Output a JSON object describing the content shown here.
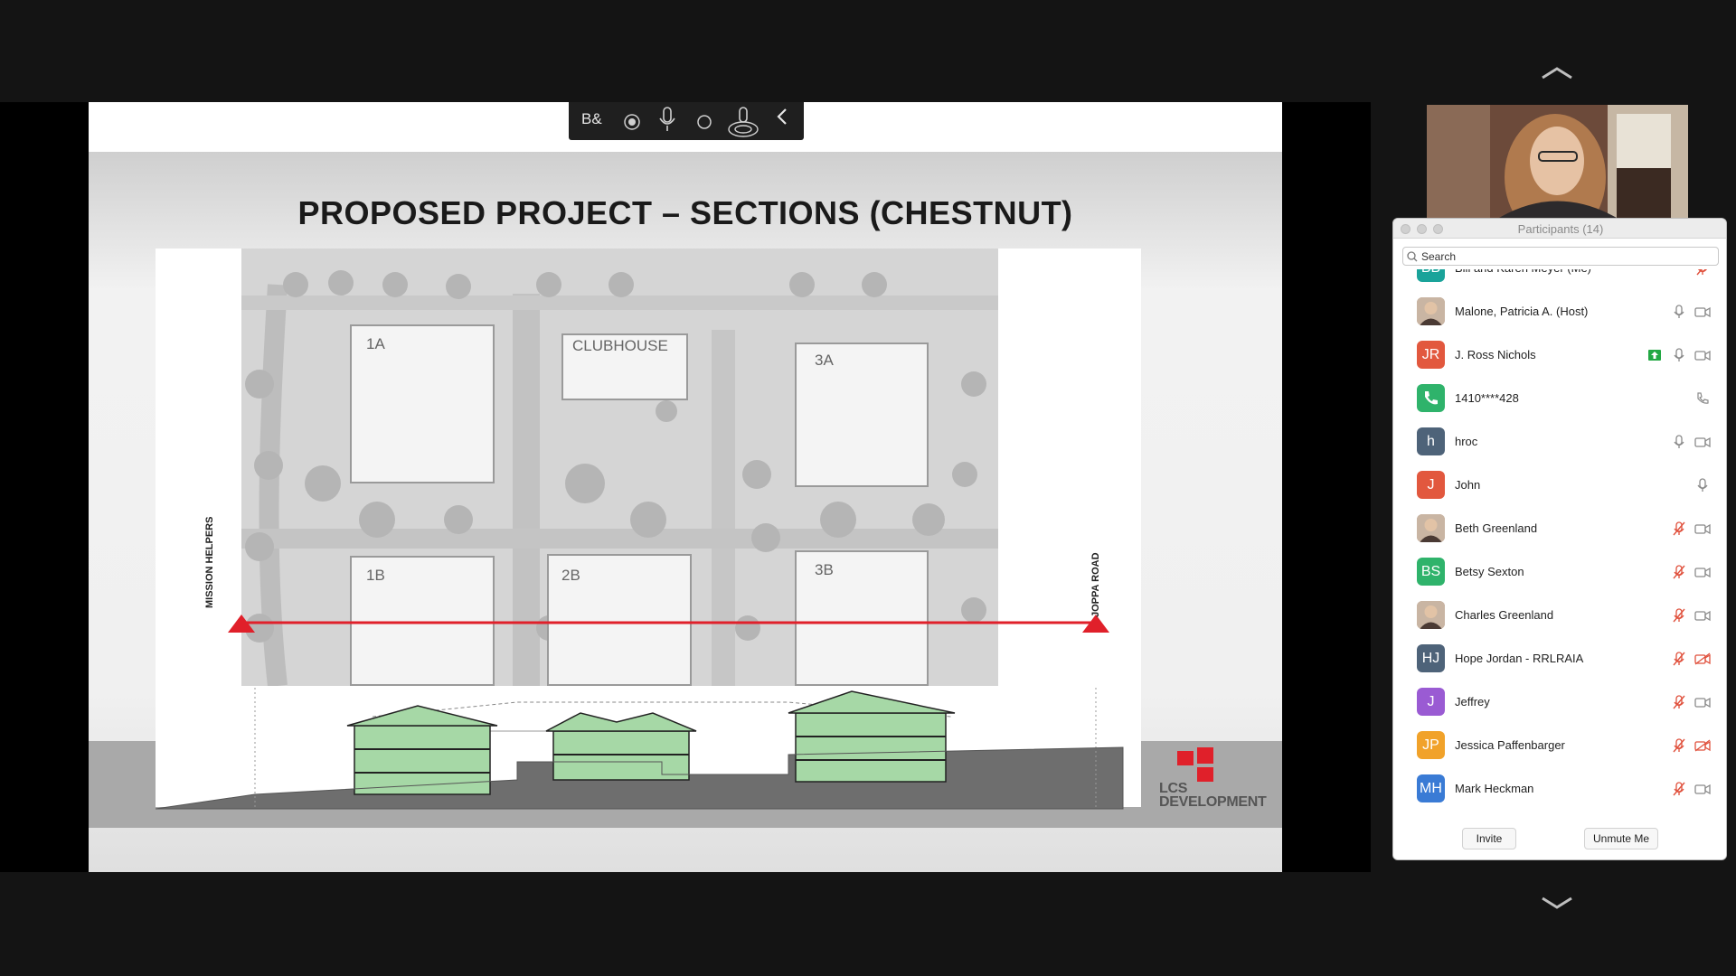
{
  "slide": {
    "title": "PROPOSED PROJECT – SECTIONS (CHESTNUT)",
    "buildings": [
      "1A",
      "CLUBHOUSE",
      "3A",
      "1B",
      "2B",
      "3B"
    ],
    "road_left": "MISSION HELPERS",
    "road_right": "JOPPA ROAD",
    "logo_line1": "LCS",
    "logo_line2": "DEVELOPMENT"
  },
  "share_toolbar": {
    "icons": [
      "annotate-icon",
      "record-dot-icon",
      "mic-icon",
      "circle-icon",
      "podcast-icon",
      "collapse-chevron-icon"
    ]
  },
  "participants_panel": {
    "title": "Participants (14)",
    "search_placeholder": "Search",
    "invite_label": "Invite",
    "unmute_label": "Unmute Me",
    "colors": {
      "green": "#2fb36b",
      "red": "#e2583e",
      "slate": "#4e6379",
      "purple": "#9a5bd3",
      "orange": "#f1a22a",
      "teal": "#1aa39a",
      "blue": "#3a7bd5",
      "muted": "#e0503c"
    },
    "rows": [
      {
        "initials": "BB",
        "name": "Bill and Karen Meyer (Me)",
        "mic": "muted",
        "video": "none",
        "color": "#1aa39a"
      },
      {
        "initials": "",
        "name": "Malone, Patricia A. (Host)",
        "mic": "on",
        "video": "on",
        "color": "photo"
      },
      {
        "initials": "JR",
        "name": "J. Ross Nichols",
        "mic": "on",
        "video": "on",
        "color": "#e2583e",
        "share": true
      },
      {
        "initials": "",
        "name": "1410****428",
        "mic": "phone",
        "video": "none",
        "color": "#2fb36b"
      },
      {
        "initials": "h",
        "name": "hroc",
        "mic": "on",
        "video": "on",
        "color": "#4e6379"
      },
      {
        "initials": "J",
        "name": "John",
        "mic": "on",
        "video": "none",
        "color": "#e2583e"
      },
      {
        "initials": "",
        "name": "Beth Greenland",
        "mic": "muted",
        "video": "on",
        "color": "photo"
      },
      {
        "initials": "BS",
        "name": "Betsy Sexton",
        "mic": "muted",
        "video": "on",
        "color": "#2fb36b"
      },
      {
        "initials": "",
        "name": "Charles Greenland",
        "mic": "muted",
        "video": "on",
        "color": "photo"
      },
      {
        "initials": "HJ",
        "name": "Hope Jordan - RRLRAIA",
        "mic": "muted",
        "video": "off",
        "color": "#4e6379"
      },
      {
        "initials": "J",
        "name": "Jeffrey",
        "mic": "muted",
        "video": "on",
        "color": "#9a5bd3"
      },
      {
        "initials": "JP",
        "name": "Jessica Paffenbarger",
        "mic": "muted",
        "video": "off",
        "color": "#f1a22a"
      },
      {
        "initials": "MH",
        "name": "Mark Heckman",
        "mic": "muted",
        "video": "on",
        "color": "#3a7bd5"
      }
    ]
  }
}
